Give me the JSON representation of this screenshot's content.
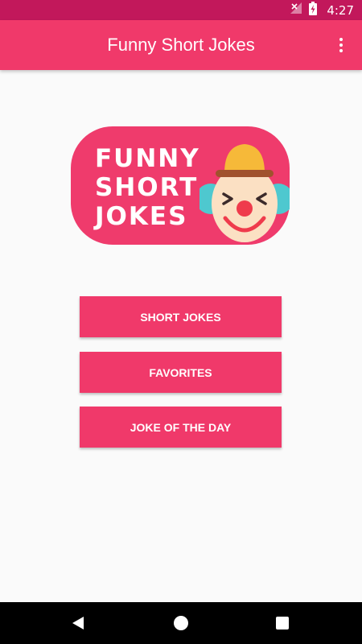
{
  "status_bar": {
    "time": "4:27",
    "icons": [
      "no-signal-icon",
      "battery-charging-icon"
    ]
  },
  "app_bar": {
    "title": "Funny Short Jokes",
    "menu_icon": "more-vertical-icon"
  },
  "logo": {
    "lines": [
      "FUNNY",
      "SHORT",
      "JOKES"
    ],
    "icon": "clown-face-icon"
  },
  "buttons": [
    {
      "label": "SHORT JOKES"
    },
    {
      "label": "FAVORITES"
    },
    {
      "label": "JOKE OF THE DAY"
    }
  ],
  "nav_bar": {
    "icons": [
      "back-icon",
      "home-icon",
      "recents-icon"
    ]
  },
  "colors": {
    "primary": "#f0396a",
    "primary_dark": "#c2185b",
    "background": "#fafafa"
  }
}
